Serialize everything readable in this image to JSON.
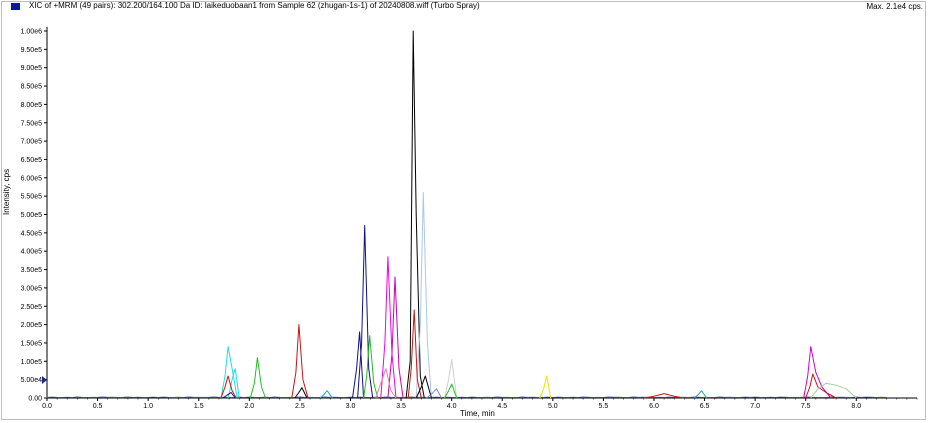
{
  "header": {
    "title": "XIC of +MRM (49 pairs): 302.200/164.100 Da ID: laikeduobaan1 from Sample 62 (zhugan-1s-1) of 20240808.wiff (Turbo Spray)",
    "max_label": "Max. 2.1e4 cps.",
    "icon": "series-color-swatch-icon",
    "icon_color": "#0a1a9c"
  },
  "chart_data": {
    "type": "line",
    "xlabel": "Time, min",
    "ylabel": "Intensity, cps",
    "xlim": [
      0.0,
      8.6
    ],
    "ylim": [
      0,
      1000000.0
    ],
    "x_ticks": [
      0.0,
      0.5,
      1.0,
      1.5,
      2.0,
      2.5,
      3.0,
      3.5,
      4.0,
      4.5,
      5.0,
      5.5,
      6.0,
      6.5,
      7.0,
      7.5,
      8.0
    ],
    "x_tick_labels": [
      "0.0",
      "0.5",
      "1.0",
      "1.5",
      "2.0",
      "2.5",
      "3.0",
      "3.5",
      "4.0",
      "4.5",
      "5.0",
      "5.5",
      "6.0",
      "6.5",
      "7.0",
      "7.5",
      "8.0"
    ],
    "y_ticks": [
      0,
      50000,
      100000,
      150000,
      200000,
      250000,
      300000,
      350000,
      400000,
      450000,
      500000,
      550000,
      600000,
      650000,
      700000,
      750000,
      800000,
      850000,
      900000,
      950000,
      1000000
    ],
    "y_tick_labels": [
      "0.00",
      "5.00e4",
      "1.00e5",
      "1.50e5",
      "2.00e5",
      "2.50e5",
      "3.00e5",
      "3.50e5",
      "4.00e5",
      "4.50e5",
      "5.00e5",
      "5.50e5",
      "6.00e5",
      "6.50e5",
      "7.00e5",
      "7.50e5",
      "8.00e5",
      "8.50e5",
      "9.00e5",
      "9.50e5",
      "1.00e6"
    ],
    "grid": false,
    "series": [
      {
        "color": "#000000",
        "x": [
          3.55,
          3.59,
          3.62,
          3.65,
          3.69,
          3.73
        ],
        "y": [
          0,
          100000,
          1000000,
          500000,
          60000,
          0
        ]
      },
      {
        "color": "#a9c9e9",
        "x": [
          3.65,
          3.69,
          3.72,
          3.76,
          3.8
        ],
        "y": [
          0,
          200000,
          560000,
          150000,
          0
        ]
      },
      {
        "color": "#10108a",
        "x": [
          3.07,
          3.11,
          3.14,
          3.18,
          3.22
        ],
        "y": [
          0,
          150000,
          470000,
          80000,
          0
        ]
      },
      {
        "color": "#10108a",
        "x": [
          3.02,
          3.06,
          3.09,
          3.13
        ],
        "y": [
          0,
          80000,
          180000,
          0
        ]
      },
      {
        "color": "#f000f0",
        "x": [
          3.3,
          3.34,
          3.37,
          3.41,
          3.45
        ],
        "y": [
          0,
          150000,
          385000,
          120000,
          0
        ]
      },
      {
        "color": "#d000b0",
        "x": [
          3.37,
          3.41,
          3.44,
          3.48,
          3.52
        ],
        "y": [
          0,
          120000,
          330000,
          80000,
          0
        ]
      },
      {
        "color": "#20c020",
        "x": [
          3.13,
          3.16,
          3.19,
          3.23,
          3.27
        ],
        "y": [
          0,
          60000,
          170000,
          40000,
          0
        ]
      },
      {
        "color": "#c81414",
        "x": [
          2.42,
          2.46,
          2.49,
          2.53,
          2.58
        ],
        "y": [
          0,
          70000,
          200000,
          50000,
          0
        ]
      },
      {
        "color": "#c81414",
        "x": [
          3.57,
          3.6,
          3.63,
          3.66,
          3.7
        ],
        "y": [
          0,
          80000,
          240000,
          50000,
          0
        ]
      },
      {
        "color": "#20e0e0",
        "x": [
          1.72,
          1.76,
          1.79,
          1.83,
          1.88
        ],
        "y": [
          0,
          60000,
          140000,
          80000,
          0
        ]
      },
      {
        "color": "#20e0e0",
        "x": [
          1.79,
          1.83,
          1.86,
          1.9
        ],
        "y": [
          0,
          50000,
          80000,
          0
        ]
      },
      {
        "color": "#c81414",
        "x": [
          1.72,
          1.76,
          1.79,
          1.83,
          1.87
        ],
        "y": [
          0,
          30000,
          60000,
          20000,
          0
        ]
      },
      {
        "color": "#20c020",
        "x": [
          2.01,
          2.05,
          2.08,
          2.12,
          2.16
        ],
        "y": [
          0,
          40000,
          110000,
          30000,
          0
        ]
      },
      {
        "color": "#d0d0d0",
        "x": [
          3.93,
          3.97,
          4.0,
          4.05
        ],
        "y": [
          0,
          50000,
          105000,
          0
        ]
      },
      {
        "color": "#20c020",
        "x": [
          3.93,
          3.97,
          4.0,
          4.05
        ],
        "y": [
          0,
          20000,
          38000,
          0
        ]
      },
      {
        "color": "#e8e800",
        "x": [
          4.87,
          4.91,
          4.94,
          4.98
        ],
        "y": [
          0,
          25000,
          60000,
          0
        ]
      },
      {
        "color": "#d000d0",
        "x": [
          7.48,
          7.52,
          7.55,
          7.6,
          7.66,
          7.75
        ],
        "y": [
          0,
          60000,
          140000,
          70000,
          30000,
          0
        ]
      },
      {
        "color": "#c81414",
        "x": [
          7.5,
          7.54,
          7.57,
          7.62,
          7.7,
          7.8
        ],
        "y": [
          0,
          30000,
          65000,
          30000,
          15000,
          0
        ]
      },
      {
        "color": "#a0d0a0",
        "x": [
          7.55,
          7.62,
          7.7,
          7.8,
          7.9,
          8.0
        ],
        "y": [
          0,
          25000,
          40000,
          35000,
          25000,
          0
        ]
      },
      {
        "color": "#2aa89a",
        "x": [
          6.4,
          6.44,
          6.47,
          6.52
        ],
        "y": [
          0,
          10000,
          20000,
          0
        ]
      },
      {
        "color": "#2aa89a",
        "x": [
          2.7,
          2.74,
          2.77,
          2.82
        ],
        "y": [
          0,
          10000,
          20000,
          0
        ]
      },
      {
        "color": "#000000",
        "x": [
          2.45,
          2.49,
          2.52,
          2.57
        ],
        "y": [
          0,
          15000,
          28000,
          0
        ]
      },
      {
        "color": "#f080a0",
        "x": [
          3.25,
          3.3,
          3.35,
          3.4,
          3.45
        ],
        "y": [
          0,
          40000,
          80000,
          20000,
          0
        ]
      },
      {
        "color": "#000000",
        "x": [
          3.65,
          3.7,
          3.74,
          3.8
        ],
        "y": [
          0,
          30000,
          60000,
          0
        ]
      },
      {
        "color": "#10108a",
        "x": [
          1.74,
          1.78,
          1.82,
          1.86
        ],
        "y": [
          0,
          8000,
          15000,
          0
        ]
      },
      {
        "color": "#c81414",
        "x": [
          5.9,
          6.0,
          6.1,
          6.2,
          6.3
        ],
        "y": [
          0,
          5000,
          12000,
          5000,
          0
        ]
      },
      {
        "color": "#8080e0",
        "x": [
          3.75,
          3.8,
          3.85,
          3.9
        ],
        "y": [
          0,
          10000,
          25000,
          0
        ]
      }
    ]
  },
  "pointer_marker": {
    "icon": "y-pointer-triangle-icon",
    "color": "#1a2a8c"
  }
}
